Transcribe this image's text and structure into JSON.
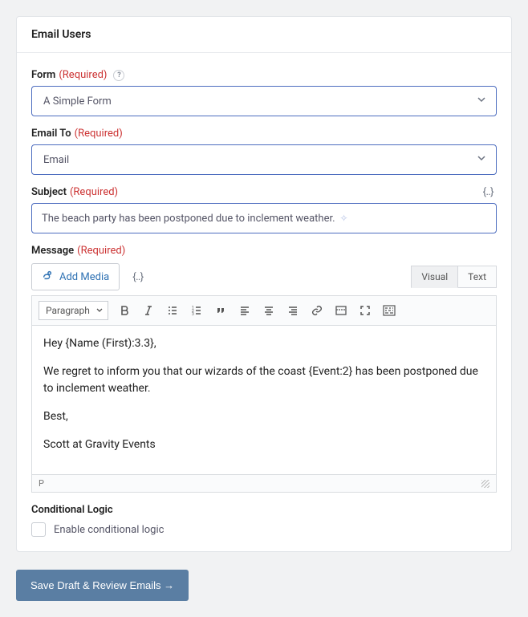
{
  "panel": {
    "title": "Email Users"
  },
  "labels": {
    "form": "Form",
    "emailTo": "Email To",
    "subject": "Subject",
    "message": "Message",
    "conditional": "Conditional Logic",
    "required": "(Required)"
  },
  "form": {
    "selected": "A Simple Form",
    "helpGlyph": "?"
  },
  "emailTo": {
    "selected": "Email"
  },
  "subject": {
    "value": "The beach party has been postponed due to inclement weather."
  },
  "editor": {
    "tabs": {
      "visual": "Visual",
      "text": "Text"
    },
    "addMedia": "Add Media",
    "formatSelect": "Paragraph",
    "body": {
      "p1": "Hey {Name (First):3.3},",
      "p2": "We regret to inform you that our wizards of the coast {Event:2} has been postponed due to inclement weather.",
      "p3": "Best,",
      "p4": "Scott at Gravity Events"
    },
    "statusPath": "P"
  },
  "conditional": {
    "checkboxLabel": "Enable conditional logic"
  },
  "actions": {
    "save": "Save Draft & Review Emails →"
  },
  "glyphs": {
    "mergeTag": "{‥}"
  }
}
